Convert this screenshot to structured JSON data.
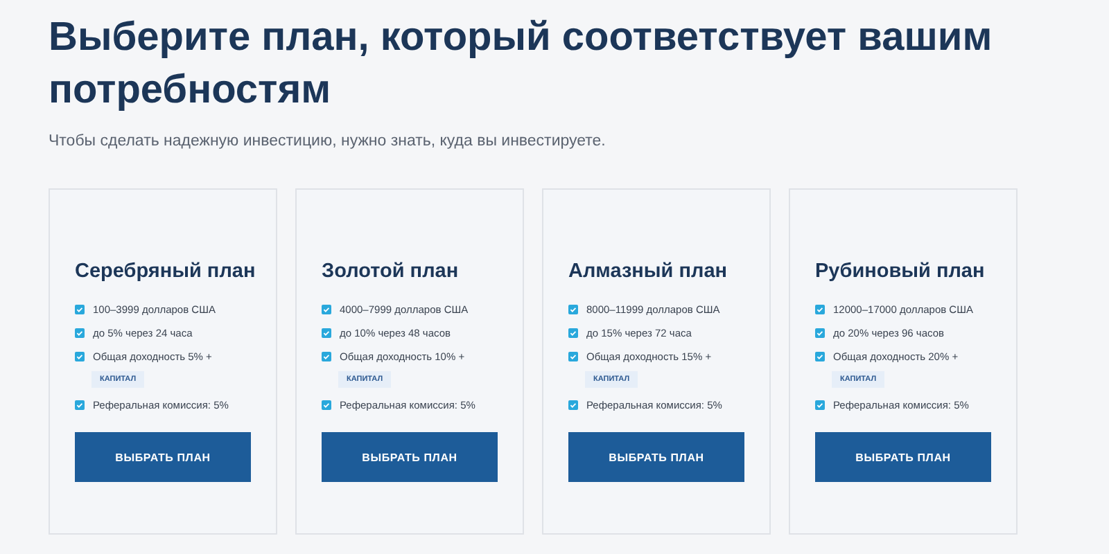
{
  "heading": "Выберите план, который соответствует вашим потребностям",
  "subtitle": "Чтобы сделать надежную инвестицию, нужно знать, куда вы инвестируете.",
  "plans": [
    {
      "title": "Серебряный план",
      "features": [
        {
          "text": "100–3999 долларов США"
        },
        {
          "text": "до 5% через 24 часа"
        },
        {
          "text": "Общая доходность 5% +",
          "tag": "КАПИТАЛ"
        },
        {
          "text": "Реферальная комиссия: 5%"
        }
      ],
      "button": "ВЫБРАТЬ ПЛАН"
    },
    {
      "title": "Золотой план",
      "features": [
        {
          "text": "4000–7999 долларов США"
        },
        {
          "text": "до 10% через 48 часов"
        },
        {
          "text": "Общая доходность 10% +",
          "tag": "КАПИТАЛ"
        },
        {
          "text": "Реферальная комиссия: 5%"
        }
      ],
      "button": "ВЫБРАТЬ ПЛАН"
    },
    {
      "title": "Алмазный план",
      "features": [
        {
          "text": "8000–11999 долларов США"
        },
        {
          "text": "до 15% через 72 часа"
        },
        {
          "text": "Общая доходность 15% +",
          "tag": "КАПИТАЛ"
        },
        {
          "text": "Реферальная комиссия: 5%"
        }
      ],
      "button": "ВЫБРАТЬ ПЛАН"
    },
    {
      "title": "Рубиновый план",
      "features": [
        {
          "text": "12000–17000 долларов США"
        },
        {
          "text": "до 20% через 96 часов"
        },
        {
          "text": "Общая доходность 20% +",
          "tag": "КАПИТАЛ"
        },
        {
          "text": "Реферальная комиссия: 5%"
        }
      ],
      "button": "ВЫБРАТЬ ПЛАН"
    }
  ]
}
